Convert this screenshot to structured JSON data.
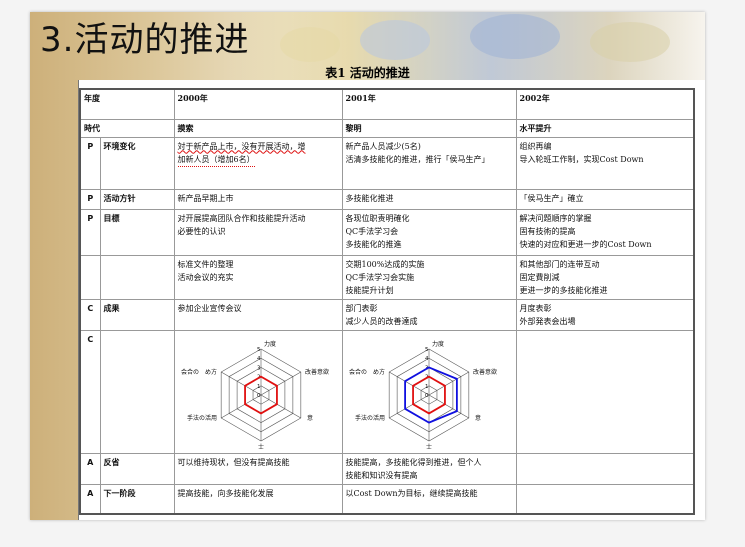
{
  "slide": {
    "title": "3.活动的推进",
    "table_caption": "表1 活动的推进"
  },
  "header": {
    "year_label": "年度",
    "years": [
      "2000年",
      "2001年",
      "2002年"
    ]
  },
  "era": {
    "label": "時代",
    "values": [
      "摸索",
      "黎明",
      "水平提升"
    ]
  },
  "rows": [
    {
      "mark": "P",
      "item": "环境变化",
      "cells": [
        [
          "for-wavy:対于新产品上市，没有开展活动，增",
          "for-dotted:加新人员（增加6名）"
        ],
        [
          "新产品人员减少(5名)",
          "活清多技能化的推进，推行「侯马生产」"
        ],
        [
          "组织再编",
          "导入轮班工作制，实现Cost Down"
        ]
      ]
    },
    {
      "mark": "P",
      "item": "活动方针",
      "cells": [
        [
          "新产品早期上市"
        ],
        [
          "多技能化推进"
        ],
        [
          "「侯马生产」確立"
        ]
      ]
    },
    {
      "mark": "P",
      "item": "目標",
      "cells": [
        [
          "对开展提高团队合作和技能提升活动",
          "必要性的认识"
        ],
        [
          "各现位职责明確化",
          "QC手法学习会",
          "多技能化的推進"
        ],
        [
          "解决问題順序的掌握",
          "固有技術的提高",
          "快速的对应和更进一步的Cost Down"
        ]
      ]
    },
    {
      "mark": "",
      "item": "",
      "cells": [
        [
          "标准文件的整理",
          "活动会议的充实"
        ],
        [
          "交期100%达成的实施",
          "QC手法学习会实施",
          "技能提升计划"
        ],
        [
          "和其他部门的连带互动",
          "固定費削減",
          "更进一步的多技能化推进"
        ]
      ]
    },
    {
      "mark": "C",
      "item": "成果",
      "cells": [
        [
          "参加企业宣传会议"
        ],
        [
          "部门表彰",
          "减少人员的改善達成"
        ],
        [
          "月度表彰",
          "外部発表会出場"
        ]
      ]
    },
    {
      "mark": "C",
      "item": "",
      "cells": [
        [],
        [],
        []
      ]
    },
    {
      "mark": "A",
      "item": "反省",
      "cells": [
        [
          "可以维持现状，但没有提高技能"
        ],
        [
          "技能提高，多技能化得到推进，但个人",
          "技能和知识没有提高"
        ],
        []
      ]
    },
    {
      "mark": "A",
      "item": "下一阶段",
      "cells": [
        [
          "提高技能，向多技能化发展"
        ],
        [
          "以Cost Down为目标，继续提高技能"
        ],
        []
      ]
    }
  ],
  "radar_labels": {
    "top": "力度",
    "upper_right": "改善意欲",
    "right": "意",
    "bottom": "士",
    "left": "手法の活用",
    "upper_left_a": "会合の",
    "upper_left_b": "め方",
    "ticks": [
      "5",
      "4",
      "3",
      "2",
      "1",
      "0"
    ]
  },
  "chart_data": [
    {
      "type": "radar",
      "title": "",
      "axes": [
        "力度",
        "改善意欲",
        "意",
        "士",
        "手法の活用",
        "会合の め方"
      ],
      "range": [
        0,
        5
      ],
      "series": [
        {
          "color": "#e01010",
          "values": [
            2,
            2,
            2,
            2,
            2,
            2
          ]
        }
      ]
    },
    {
      "type": "radar",
      "title": "",
      "axes": [
        "力度",
        "改善意欲",
        "意",
        "士",
        "手法の活用",
        "会合の め方"
      ],
      "range": [
        0,
        5
      ],
      "series": [
        {
          "color": "#e01010",
          "values": [
            2,
            2,
            2,
            2,
            2,
            2
          ]
        },
        {
          "color": "#1010e0",
          "values": [
            3,
            3.5,
            3.5,
            3,
            3,
            3
          ]
        }
      ]
    }
  ],
  "colors": {
    "annotation_red": "#d11111",
    "series_red": "#e01010",
    "series_blue": "#1010e0"
  }
}
